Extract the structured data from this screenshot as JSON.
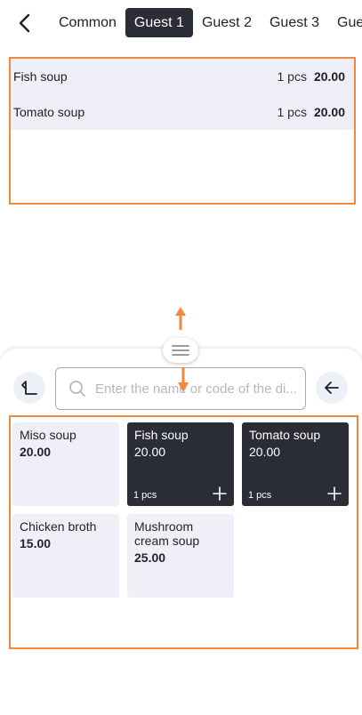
{
  "tabs": [
    "Common",
    "Guest 1",
    "Guest 2",
    "Guest 3",
    "Guest"
  ],
  "active_tab": "Guest 1",
  "order_items": [
    {
      "name": "Fish soup",
      "qty": "1 pcs",
      "price": "20.00"
    },
    {
      "name": "Tomato soup",
      "qty": "1 pcs",
      "price": "20.00"
    }
  ],
  "search": {
    "placeholder": "Enter the name or code of the di...",
    "value": ""
  },
  "menu_items": [
    {
      "name": "Miso soup",
      "price": "20.00",
      "qty": "",
      "selected": false
    },
    {
      "name": "Fish soup",
      "price": "20.00",
      "qty": "1 pcs",
      "selected": true
    },
    {
      "name": "Tomato soup",
      "price": "20.00",
      "qty": "1 pcs",
      "selected": true
    },
    {
      "name": "Chicken broth",
      "price": "15.00",
      "qty": "",
      "selected": false
    },
    {
      "name": "Mushroom cream soup",
      "price": "25.00",
      "qty": "",
      "selected": false
    }
  ],
  "icons": {
    "back": "chevron-left-icon",
    "up": "arrow-up-left-icon",
    "left": "arrow-left-icon",
    "search": "search-icon",
    "plus": "plus-icon",
    "handle": "drag-handle-icon"
  },
  "colors": {
    "accent": "#f0883e",
    "dark": "#2a2d35",
    "tile": "#eff0f7"
  }
}
